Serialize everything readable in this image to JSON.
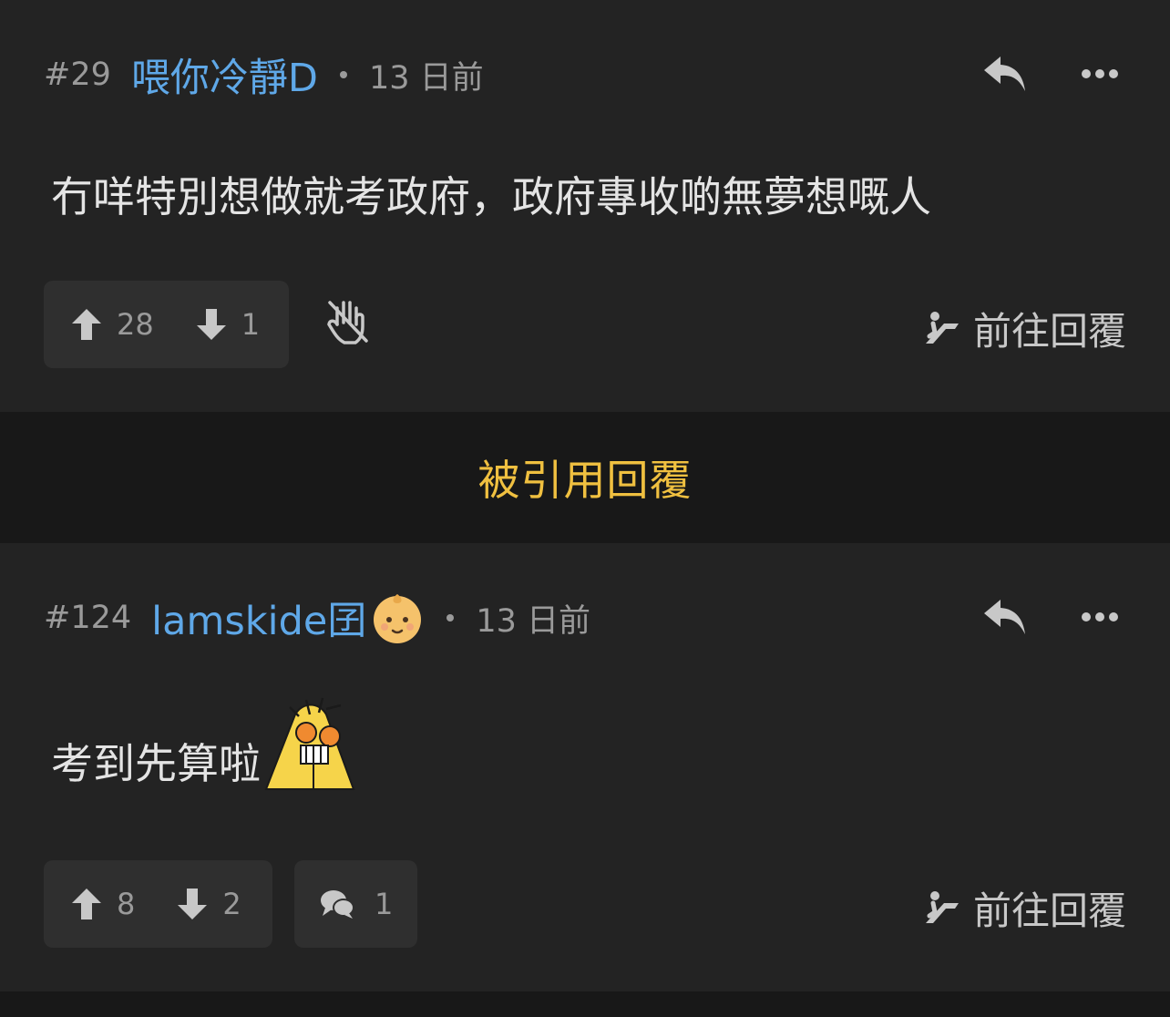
{
  "posts": [
    {
      "floor": "#29",
      "username": "喂你冷靜D",
      "time": "13 日前",
      "content": "冇咩特別想做就考政府，政府專收啲無夢想嘅人",
      "upvotes": "28",
      "downvotes": "1",
      "goto_label": "前往回覆"
    },
    {
      "floor": "#124",
      "username": "lamskide囝",
      "time": "13 日前",
      "content": "考到先算啦",
      "upvotes": "8",
      "downvotes": "2",
      "comments": "1",
      "goto_label": "前往回覆"
    }
  ],
  "quoted_bar_label": "被引用回覆",
  "colors": {
    "background": "#232323",
    "divider": "#181818",
    "username": "#5fa8e8",
    "accent": "#f0c040",
    "muted": "#9a9a9a"
  },
  "icons": [
    "reply-icon",
    "more-icon",
    "upvote-icon",
    "downvote-icon",
    "block-hand-icon",
    "comment-icon",
    "goto-reply-icon",
    "baby-emoji-icon",
    "sticker-image"
  ]
}
